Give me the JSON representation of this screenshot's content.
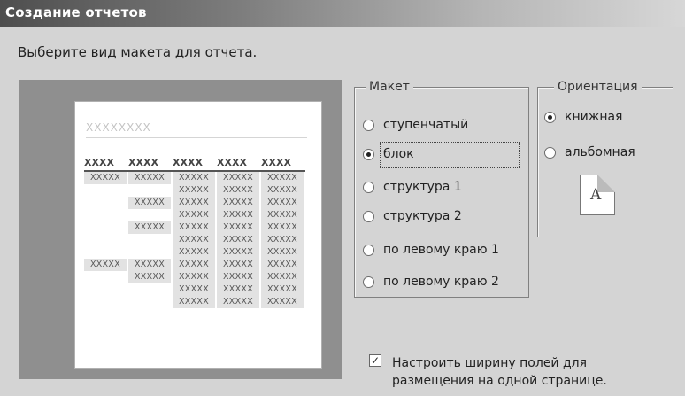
{
  "window": {
    "title": "Создание отчетов"
  },
  "prompt": "Выберите вид макета для отчета.",
  "preview": {
    "heading": "XXXXXXXX",
    "columns": [
      "XXXX",
      "XXXX",
      "XXXX",
      "XXXX",
      "XXXX"
    ],
    "rows": [
      [
        "XXXXX",
        "XXXXX",
        "XXXXX",
        "XXXXX",
        "XXXXX"
      ],
      [
        "",
        "",
        "XXXXX",
        "XXXXX",
        "XXXXX"
      ],
      [
        "",
        "XXXXX",
        "XXXXX",
        "XXXXX",
        "XXXXX"
      ],
      [
        "",
        "",
        "XXXXX",
        "XXXXX",
        "XXXXX"
      ],
      [
        "",
        "XXXXX",
        "XXXXX",
        "XXXXX",
        "XXXXX"
      ],
      [
        "",
        "",
        "XXXXX",
        "XXXXX",
        "XXXXX"
      ],
      [
        "",
        "",
        "XXXXX",
        "XXXXX",
        "XXXXX"
      ],
      [
        "XXXXX",
        "XXXXX",
        "XXXXX",
        "XXXXX",
        "XXXXX"
      ],
      [
        "",
        "XXXXX",
        "XXXXX",
        "XXXXX",
        "XXXXX"
      ],
      [
        "",
        "",
        "XXXXX",
        "XXXXX",
        "XXXXX"
      ],
      [
        "",
        "",
        "XXXXX",
        "XXXXX",
        "XXXXX"
      ]
    ]
  },
  "layout_group": {
    "label": "Макет",
    "options": [
      "ступенчатый",
      "блок",
      "структура 1",
      "структура 2",
      "по левому краю 1",
      "по левому краю 2"
    ],
    "selected": "блок"
  },
  "orientation_group": {
    "label": "Ориентация",
    "options": [
      "книжная",
      "альбомная"
    ],
    "selected": "книжная",
    "icon_letter": "A"
  },
  "fit_checkbox": {
    "checked": true,
    "line1": "Настроить ширину полей для",
    "line2": "размещения на одной странице."
  }
}
